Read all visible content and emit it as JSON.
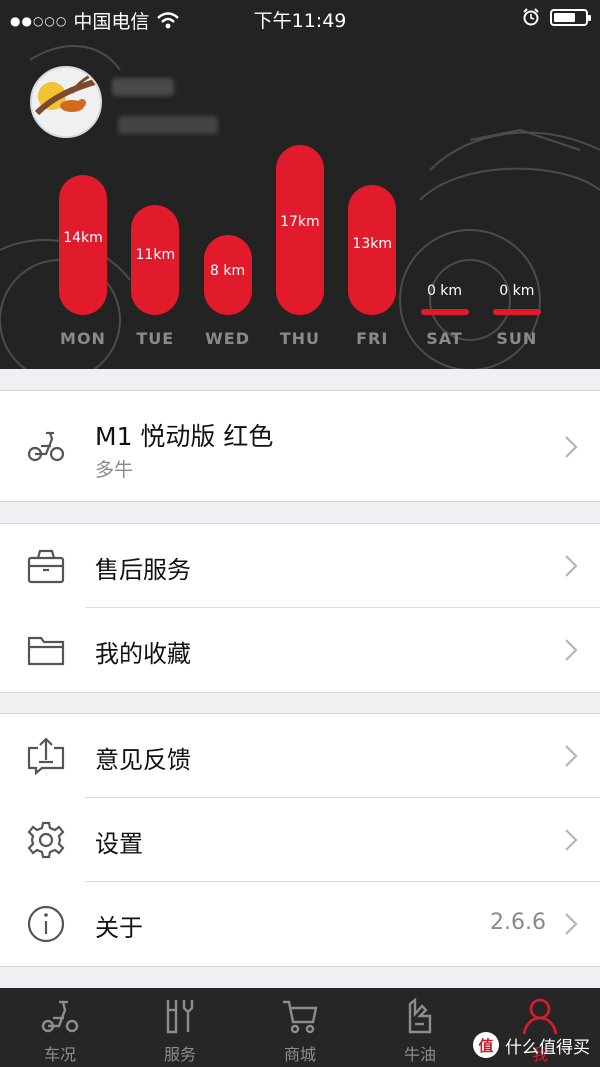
{
  "status_bar": {
    "signal": "●●○○○",
    "carrier": "中国电信",
    "time": "下午11:49",
    "battery_level": 0.7
  },
  "chart_data": {
    "type": "bar",
    "categories": [
      "MON",
      "TUE",
      "WED",
      "THU",
      "FRI",
      "SAT",
      "SUN"
    ],
    "values": [
      14,
      11,
      8,
      17,
      13,
      0,
      0
    ],
    "labels": [
      "14km",
      "11km",
      "8 km",
      "17km",
      "13km",
      "0 km",
      "0 km"
    ],
    "unit": "km",
    "bar_color": "#e11b2c"
  },
  "vehicle": {
    "model": "M1 悦动版 红色",
    "brand": "多牛"
  },
  "menu_group1": [
    {
      "label": "售后服务"
    },
    {
      "label": "我的收藏"
    }
  ],
  "menu_group2": [
    {
      "label": "意见反馈"
    },
    {
      "label": "设置"
    },
    {
      "label": "关于",
      "value": "2.6.6"
    }
  ],
  "tabs": [
    {
      "label": "车况",
      "icon": "scooter-icon"
    },
    {
      "label": "服务",
      "icon": "wrench-icon"
    },
    {
      "label": "商城",
      "icon": "cart-icon"
    },
    {
      "label": "牛油",
      "icon": "hand-icon"
    },
    {
      "label": "我",
      "icon": "person-icon",
      "active": true
    }
  ],
  "watermark": {
    "badge": "值",
    "text": "什么值得买"
  },
  "colors": {
    "accent": "#e11b2c",
    "header_bg": "#232323",
    "tabbar_bg": "#262626"
  }
}
